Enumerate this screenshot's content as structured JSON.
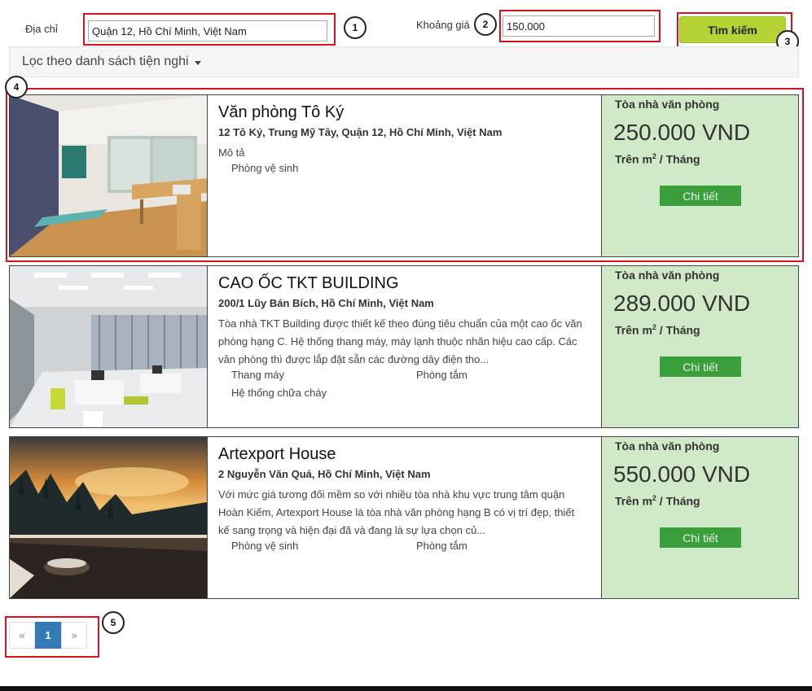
{
  "search": {
    "address_label": "Địa chỉ",
    "address_value": "Quận 12, Hồ Chí Minh, Việt Nam",
    "price_label": "Khoảng giá",
    "price_value": "150.000",
    "button_label": "Tìm kiếm"
  },
  "filter": {
    "label": "Lọc theo danh sách tiện nghi"
  },
  "callouts": [
    "1",
    "2",
    "3",
    "4",
    "5"
  ],
  "listings": [
    {
      "name": "Văn phòng Tô Ký",
      "address": "12 Tô Ký, Trung Mỹ Tây, Quận 12, Hồ Chí Minh, Việt Nam",
      "description": "Mô tả",
      "amenities": [
        "Phòng vệ sinh"
      ],
      "type": "Tòa nhà văn phòng",
      "price": "250.000 VND",
      "unit_prefix": "Trên m",
      "unit_sup": "2",
      "unit_suffix": " / Tháng",
      "detail_label": "Chi tiết"
    },
    {
      "name": "CAO ỐC TKT BUILDING",
      "address": "200/1 Lũy Bán Bích, Hồ Chí Minh, Việt Nam",
      "description": "Tòa nhà TKT Building được thiết kế theo đúng tiêu chuẩn của một cao ốc văn phòng hạng C. Hệ thống thang máy, máy lạnh thuộc nhãn hiệu cao cấp. Các văn phòng thì được lắp đặt sẵn các đường dây điện tho...",
      "amenities": [
        "Thang máy",
        "Phòng tắm",
        "Hệ thống chữa cháy"
      ],
      "type": "Tòa nhà văn phòng",
      "price": "289.000 VND",
      "unit_prefix": "Trên m",
      "unit_sup": "2",
      "unit_suffix": " / Tháng",
      "detail_label": "Chi tiết"
    },
    {
      "name": "Artexport House",
      "address": "2 Nguyễn Văn Quá, Hồ Chí Minh, Việt Nam",
      "description": "Với mức giá tương đối mềm so với nhiều tòa nhà khu vực trung tâm quận Hoàn Kiếm, Artexport House là tòa nhà văn phòng hạng B có vị trí đẹp, thiết kế sang trọng và hiện đại đã và đang là sự lựa chọn củ...",
      "amenities": [
        "Phòng vệ sinh",
        "Phòng tắm"
      ],
      "type": "Tòa nhà văn phòng",
      "price": "550.000 VND",
      "unit_prefix": "Trên m",
      "unit_sup": "2",
      "unit_suffix": " / Tháng",
      "detail_label": "Chi tiết"
    }
  ],
  "pagination": {
    "prev": "«",
    "current": "1",
    "next": "»"
  },
  "colors": {
    "highlight": "#d9121f",
    "search_button": "#b5d335",
    "price_panel": "#d0e9c6",
    "detail_button": "#3a9e3a",
    "active_page": "#337ab7"
  },
  "icons": {
    "filter_dropdown": "caret-down-icon"
  }
}
